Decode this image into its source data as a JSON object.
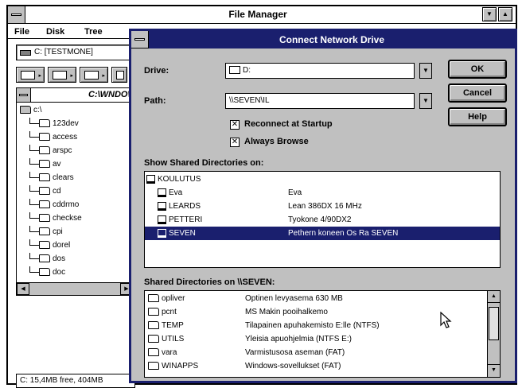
{
  "file_manager": {
    "title": "File Manager",
    "menu": [
      "File",
      "Disk",
      "Tree"
    ],
    "drive_combo": "C: [TESTMONE]",
    "tree_window_title": "C:\\WNDOW",
    "tree": [
      "c:\\",
      "123dev",
      "access",
      "arspc",
      "av",
      "clears",
      "cd",
      "cddrmo",
      "checkse",
      "cpi",
      "dorel",
      "dos",
      "doc"
    ],
    "status": "C: 15,4MB free, 404MB"
  },
  "dialog": {
    "title": "Connect Network Drive",
    "drive_label": "Drive:",
    "drive_value": "D:",
    "path_label": "Path:",
    "path_value": "\\\\SEVEN\\IL",
    "buttons": {
      "ok": "OK",
      "cancel": "Cancel",
      "help": "Help"
    },
    "reconnect_label": "Reconnect at Startup",
    "always_browse_label": "Always Browse",
    "show_shared_label": "Show Shared Directories on:",
    "computers": [
      {
        "name": "KOULUTUS",
        "comment": "",
        "selected": false,
        "group": true
      },
      {
        "name": "Eva",
        "comment": "Eva",
        "selected": false,
        "group": false
      },
      {
        "name": "LEARDS",
        "comment": "Lean 386DX 16 MHz",
        "selected": false,
        "group": false
      },
      {
        "name": "PETTERI",
        "comment": "Tyokone 4/90DX2",
        "selected": false,
        "group": false
      },
      {
        "name": "SEVEN",
        "comment": "Pethern koneen Os Ra SEVEN",
        "selected": true,
        "group": false
      }
    ],
    "shared_on_label": "Shared Directories on \\\\SEVEN:",
    "shares": [
      {
        "name": "opliver",
        "comment": "Optinen levyasema 630 MB"
      },
      {
        "name": "pcnt",
        "comment": "MS Makin pooihalkemo"
      },
      {
        "name": "TEMP",
        "comment": "Tilapainen apuhakemisto E:lle (NTFS)"
      },
      {
        "name": "UTILS",
        "comment": "Yleisia apuohjelmia (NTFS E:)"
      },
      {
        "name": "vara",
        "comment": "Varmistusosa aseman (FAT)"
      },
      {
        "name": "WINAPPS",
        "comment": "Windows-sovellukset (FAT)"
      }
    ]
  }
}
